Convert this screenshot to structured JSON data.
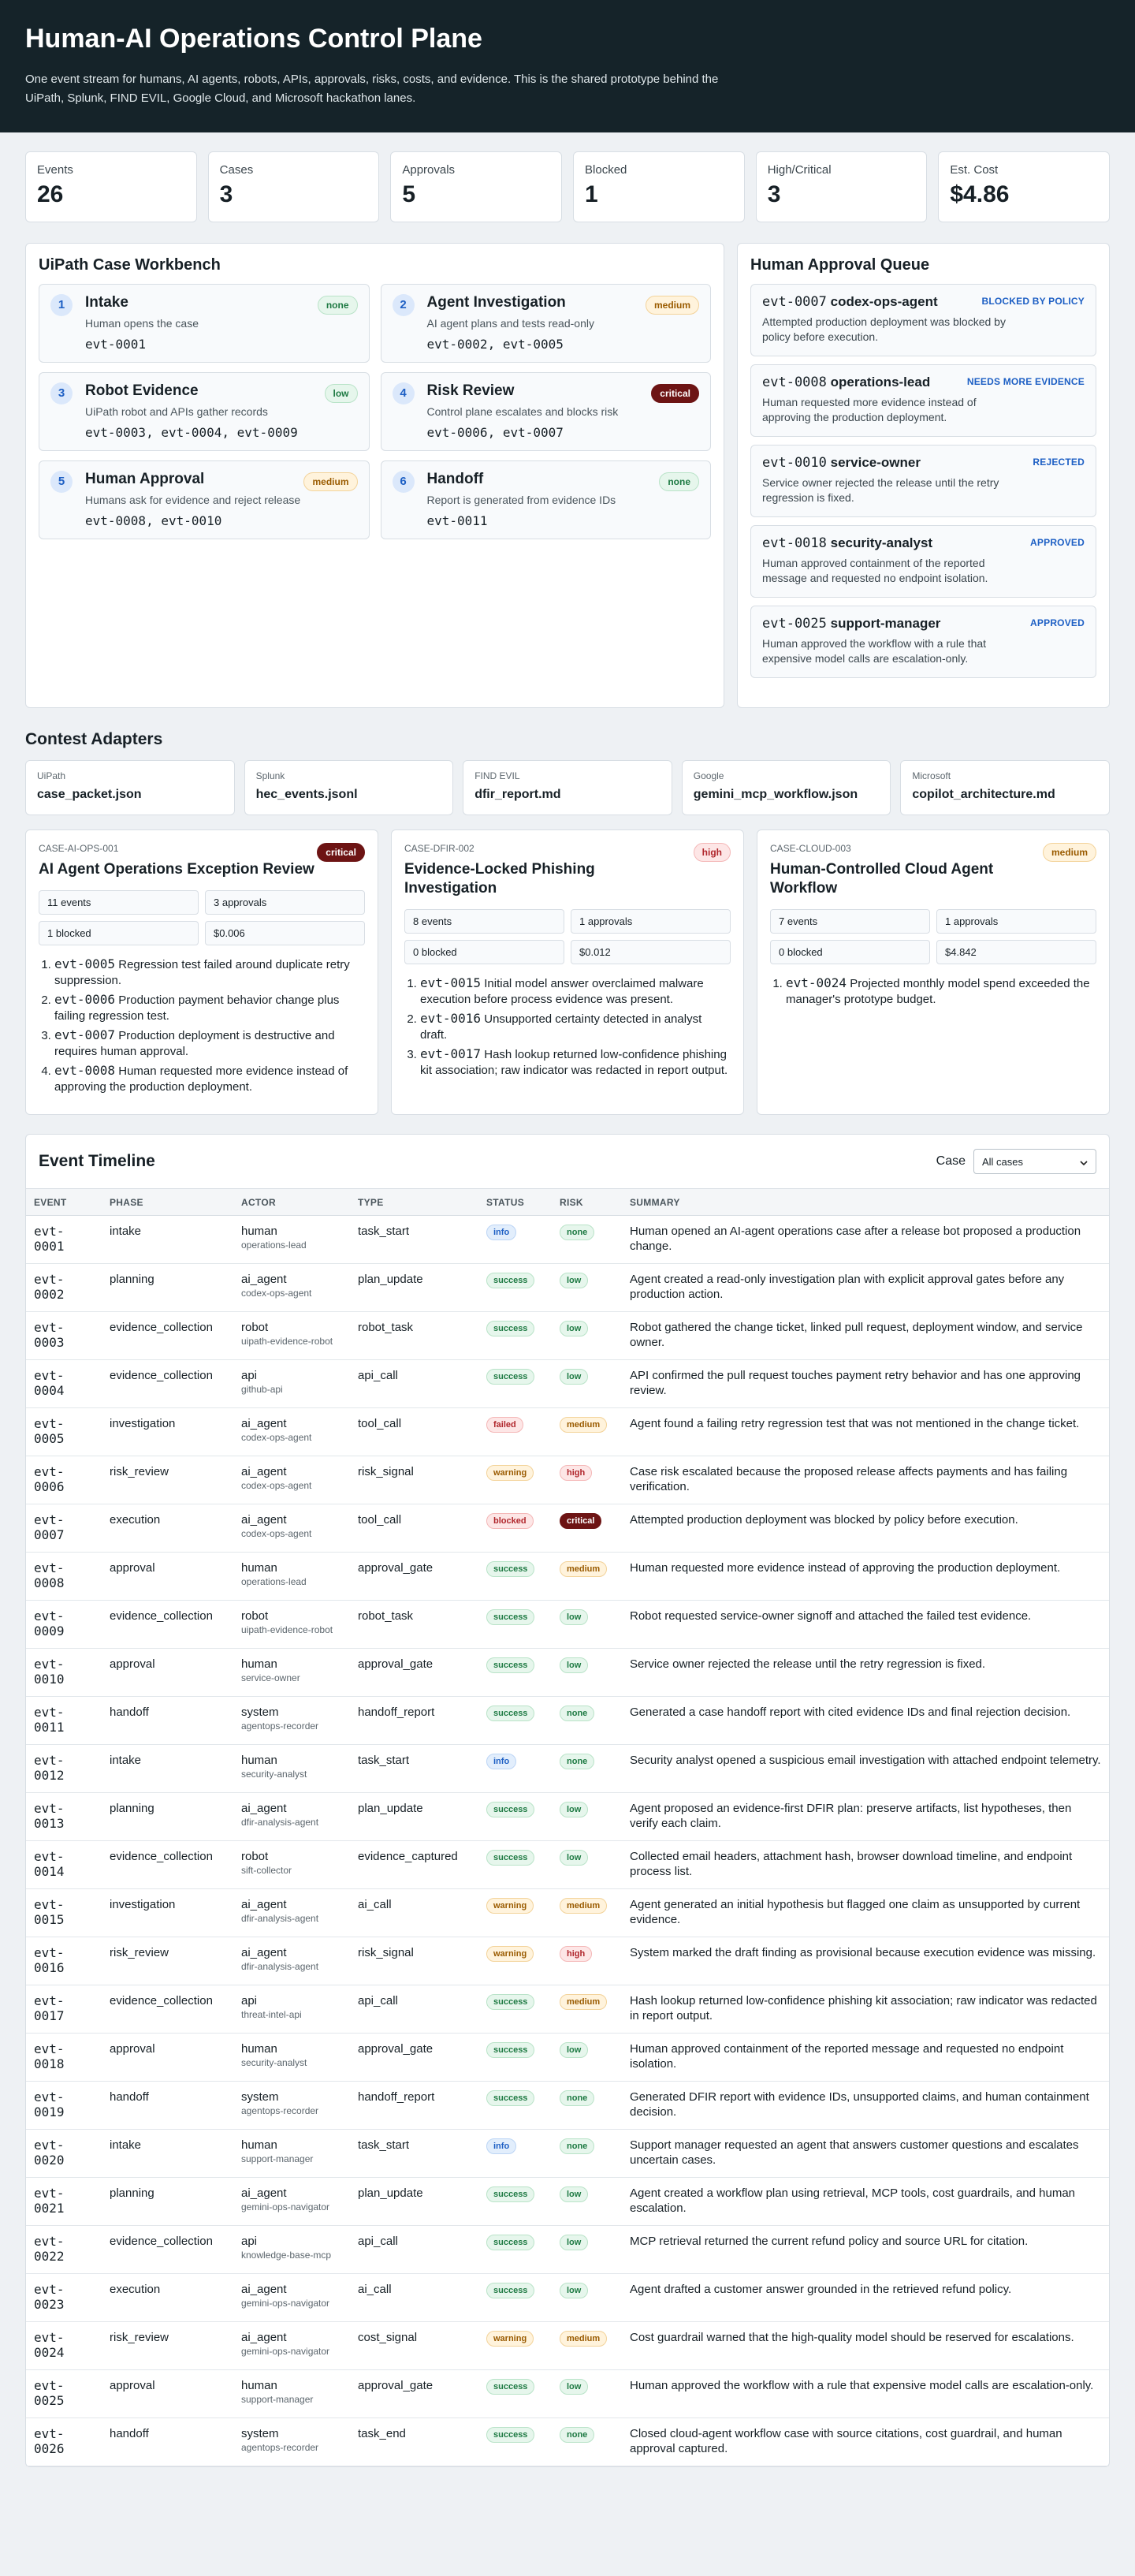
{
  "header": {
    "title": "Human-AI Operations Control Plane",
    "subtitle": "One event stream for humans, AI agents, robots, APIs, approvals, risks, costs, and evidence. This is the shared prototype behind the UiPath, Splunk, FIND EVIL, Google Cloud, and Microsoft hackathon lanes."
  },
  "stats": [
    {
      "label": "Events",
      "value": "26"
    },
    {
      "label": "Cases",
      "value": "3"
    },
    {
      "label": "Approvals",
      "value": "5"
    },
    {
      "label": "Blocked",
      "value": "1"
    },
    {
      "label": "High/Critical",
      "value": "3"
    },
    {
      "label": "Est. Cost",
      "value": "$4.86"
    }
  ],
  "workbench": {
    "title": "UiPath Case Workbench",
    "stages": [
      {
        "num": "1",
        "title": "Intake",
        "desc": "Human opens the case",
        "events": "evt-0001",
        "risk": "none"
      },
      {
        "num": "2",
        "title": "Agent Investigation",
        "desc": "AI agent plans and tests read-only",
        "events": "evt-0002, evt-0005",
        "risk": "medium"
      },
      {
        "num": "3",
        "title": "Robot Evidence",
        "desc": "UiPath robot and APIs gather records",
        "events": "evt-0003, evt-0004, evt-0009",
        "risk": "low"
      },
      {
        "num": "4",
        "title": "Risk Review",
        "desc": "Control plane escalates and blocks risk",
        "events": "evt-0006, evt-0007",
        "risk": "critical"
      },
      {
        "num": "5",
        "title": "Human Approval",
        "desc": "Humans ask for evidence and reject release",
        "events": "evt-0008, evt-0010",
        "risk": "medium"
      },
      {
        "num": "6",
        "title": "Handoff",
        "desc": "Report is generated from evidence IDs",
        "events": "evt-0011",
        "risk": "none"
      }
    ]
  },
  "queue": {
    "title": "Human Approval Queue",
    "items": [
      {
        "evt": "evt-0007",
        "actor": "codex-ops-agent",
        "status": "BLOCKED BY POLICY",
        "desc": "Attempted production deployment was blocked by policy before execution."
      },
      {
        "evt": "evt-0008",
        "actor": "operations-lead",
        "status": "NEEDS MORE EVIDENCE",
        "desc": "Human requested more evidence instead of approving the production deployment."
      },
      {
        "evt": "evt-0010",
        "actor": "service-owner",
        "status": "REJECTED",
        "desc": "Service owner rejected the release until the retry regression is fixed."
      },
      {
        "evt": "evt-0018",
        "actor": "security-analyst",
        "status": "APPROVED",
        "desc": "Human approved containment of the reported message and requested no endpoint isolation."
      },
      {
        "evt": "evt-0025",
        "actor": "support-manager",
        "status": "APPROVED",
        "desc": "Human approved the workflow with a rule that expensive model calls are escalation-only."
      }
    ]
  },
  "adapters": {
    "title": "Contest Adapters",
    "items": [
      {
        "vendor": "UiPath",
        "file": "case_packet.json"
      },
      {
        "vendor": "Splunk",
        "file": "hec_events.jsonl"
      },
      {
        "vendor": "FIND EVIL",
        "file": "dfir_report.md"
      },
      {
        "vendor": "Google",
        "file": "gemini_mcp_workflow.json"
      },
      {
        "vendor": "Microsoft",
        "file": "copilot_architecture.md"
      }
    ]
  },
  "cases": [
    {
      "id": "CASE-AI-OPS-001",
      "risk": "critical",
      "title": "AI Agent Operations Exception Review",
      "events": "11 events",
      "approvals": "3 approvals",
      "blocked": "1 blocked",
      "cost": "$0.006",
      "items": [
        {
          "evt": "evt-0005",
          "text": "Regression test failed around duplicate retry suppression."
        },
        {
          "evt": "evt-0006",
          "text": "Production payment behavior change plus failing regression test."
        },
        {
          "evt": "evt-0007",
          "text": "Production deployment is destructive and requires human approval."
        },
        {
          "evt": "evt-0008",
          "text": "Human requested more evidence instead of approving the production deployment."
        }
      ]
    },
    {
      "id": "CASE-DFIR-002",
      "risk": "high",
      "title": "Evidence-Locked Phishing Investigation",
      "events": "8 events",
      "approvals": "1 approvals",
      "blocked": "0 blocked",
      "cost": "$0.012",
      "items": [
        {
          "evt": "evt-0015",
          "text": "Initial model answer overclaimed malware execution before process evidence was present."
        },
        {
          "evt": "evt-0016",
          "text": "Unsupported certainty detected in analyst draft."
        },
        {
          "evt": "evt-0017",
          "text": "Hash lookup returned low-confidence phishing kit association; raw indicator was redacted in report output."
        }
      ]
    },
    {
      "id": "CASE-CLOUD-003",
      "risk": "medium",
      "title": "Human-Controlled Cloud Agent Workflow",
      "events": "7 events",
      "approvals": "1 approvals",
      "blocked": "0 blocked",
      "cost": "$4.842",
      "items": [
        {
          "evt": "evt-0024",
          "text": "Projected monthly model spend exceeded the manager's prototype budget."
        }
      ]
    }
  ],
  "timeline": {
    "title": "Event Timeline",
    "filter_label": "Case",
    "filter_value": "All cases",
    "columns": [
      "EVENT",
      "PHASE",
      "ACTOR",
      "TYPE",
      "STATUS",
      "RISK",
      "SUMMARY"
    ],
    "rows": [
      {
        "evt": "evt-0001",
        "phase": "intake",
        "actor": "human",
        "actor_id": "operations-lead",
        "type": "task_start",
        "status": "info",
        "risk": "none",
        "summary": "Human opened an AI-agent operations case after a release bot proposed a production change."
      },
      {
        "evt": "evt-0002",
        "phase": "planning",
        "actor": "ai_agent",
        "actor_id": "codex-ops-agent",
        "type": "plan_update",
        "status": "success",
        "risk": "low",
        "summary": "Agent created a read-only investigation plan with explicit approval gates before any production action."
      },
      {
        "evt": "evt-0003",
        "phase": "evidence_collection",
        "actor": "robot",
        "actor_id": "uipath-evidence-robot",
        "type": "robot_task",
        "status": "success",
        "risk": "low",
        "summary": "Robot gathered the change ticket, linked pull request, deployment window, and service owner."
      },
      {
        "evt": "evt-0004",
        "phase": "evidence_collection",
        "actor": "api",
        "actor_id": "github-api",
        "type": "api_call",
        "status": "success",
        "risk": "low",
        "summary": "API confirmed the pull request touches payment retry behavior and has one approving review."
      },
      {
        "evt": "evt-0005",
        "phase": "investigation",
        "actor": "ai_agent",
        "actor_id": "codex-ops-agent",
        "type": "tool_call",
        "status": "failed",
        "risk": "medium",
        "summary": "Agent found a failing retry regression test that was not mentioned in the change ticket."
      },
      {
        "evt": "evt-0006",
        "phase": "risk_review",
        "actor": "ai_agent",
        "actor_id": "codex-ops-agent",
        "type": "risk_signal",
        "status": "warning",
        "risk": "high",
        "summary": "Case risk escalated because the proposed release affects payments and has failing verification."
      },
      {
        "evt": "evt-0007",
        "phase": "execution",
        "actor": "ai_agent",
        "actor_id": "codex-ops-agent",
        "type": "tool_call",
        "status": "blocked",
        "risk": "critical",
        "summary": "Attempted production deployment was blocked by policy before execution."
      },
      {
        "evt": "evt-0008",
        "phase": "approval",
        "actor": "human",
        "actor_id": "operations-lead",
        "type": "approval_gate",
        "status": "success",
        "risk": "medium",
        "summary": "Human requested more evidence instead of approving the production deployment."
      },
      {
        "evt": "evt-0009",
        "phase": "evidence_collection",
        "actor": "robot",
        "actor_id": "uipath-evidence-robot",
        "type": "robot_task",
        "status": "success",
        "risk": "low",
        "summary": "Robot requested service-owner signoff and attached the failed test evidence."
      },
      {
        "evt": "evt-0010",
        "phase": "approval",
        "actor": "human",
        "actor_id": "service-owner",
        "type": "approval_gate",
        "status": "success",
        "risk": "low",
        "summary": "Service owner rejected the release until the retry regression is fixed."
      },
      {
        "evt": "evt-0011",
        "phase": "handoff",
        "actor": "system",
        "actor_id": "agentops-recorder",
        "type": "handoff_report",
        "status": "success",
        "risk": "none",
        "summary": "Generated a case handoff report with cited evidence IDs and final rejection decision."
      },
      {
        "evt": "evt-0012",
        "phase": "intake",
        "actor": "human",
        "actor_id": "security-analyst",
        "type": "task_start",
        "status": "info",
        "risk": "none",
        "summary": "Security analyst opened a suspicious email investigation with attached endpoint telemetry."
      },
      {
        "evt": "evt-0013",
        "phase": "planning",
        "actor": "ai_agent",
        "actor_id": "dfir-analysis-agent",
        "type": "plan_update",
        "status": "success",
        "risk": "low",
        "summary": "Agent proposed an evidence-first DFIR plan: preserve artifacts, list hypotheses, then verify each claim."
      },
      {
        "evt": "evt-0014",
        "phase": "evidence_collection",
        "actor": "robot",
        "actor_id": "sift-collector",
        "type": "evidence_captured",
        "status": "success",
        "risk": "low",
        "summary": "Collected email headers, attachment hash, browser download timeline, and endpoint process list."
      },
      {
        "evt": "evt-0015",
        "phase": "investigation",
        "actor": "ai_agent",
        "actor_id": "dfir-analysis-agent",
        "type": "ai_call",
        "status": "warning",
        "risk": "medium",
        "summary": "Agent generated an initial hypothesis but flagged one claim as unsupported by current evidence."
      },
      {
        "evt": "evt-0016",
        "phase": "risk_review",
        "actor": "ai_agent",
        "actor_id": "dfir-analysis-agent",
        "type": "risk_signal",
        "status": "warning",
        "risk": "high",
        "summary": "System marked the draft finding as provisional because execution evidence was missing."
      },
      {
        "evt": "evt-0017",
        "phase": "evidence_collection",
        "actor": "api",
        "actor_id": "threat-intel-api",
        "type": "api_call",
        "status": "success",
        "risk": "medium",
        "summary": "Hash lookup returned low-confidence phishing kit association; raw indicator was redacted in report output."
      },
      {
        "evt": "evt-0018",
        "phase": "approval",
        "actor": "human",
        "actor_id": "security-analyst",
        "type": "approval_gate",
        "status": "success",
        "risk": "low",
        "summary": "Human approved containment of the reported message and requested no endpoint isolation."
      },
      {
        "evt": "evt-0019",
        "phase": "handoff",
        "actor": "system",
        "actor_id": "agentops-recorder",
        "type": "handoff_report",
        "status": "success",
        "risk": "none",
        "summary": "Generated DFIR report with evidence IDs, unsupported claims, and human containment decision."
      },
      {
        "evt": "evt-0020",
        "phase": "intake",
        "actor": "human",
        "actor_id": "support-manager",
        "type": "task_start",
        "status": "info",
        "risk": "none",
        "summary": "Support manager requested an agent that answers customer questions and escalates uncertain cases."
      },
      {
        "evt": "evt-0021",
        "phase": "planning",
        "actor": "ai_agent",
        "actor_id": "gemini-ops-navigator",
        "type": "plan_update",
        "status": "success",
        "risk": "low",
        "summary": "Agent created a workflow plan using retrieval, MCP tools, cost guardrails, and human escalation."
      },
      {
        "evt": "evt-0022",
        "phase": "evidence_collection",
        "actor": "api",
        "actor_id": "knowledge-base-mcp",
        "type": "api_call",
        "status": "success",
        "risk": "low",
        "summary": "MCP retrieval returned the current refund policy and source URL for citation."
      },
      {
        "evt": "evt-0023",
        "phase": "execution",
        "actor": "ai_agent",
        "actor_id": "gemini-ops-navigator",
        "type": "ai_call",
        "status": "success",
        "risk": "low",
        "summary": "Agent drafted a customer answer grounded in the retrieved refund policy."
      },
      {
        "evt": "evt-0024",
        "phase": "risk_review",
        "actor": "ai_agent",
        "actor_id": "gemini-ops-navigator",
        "type": "cost_signal",
        "status": "warning",
        "risk": "medium",
        "summary": "Cost guardrail warned that the high-quality model should be reserved for escalations."
      },
      {
        "evt": "evt-0025",
        "phase": "approval",
        "actor": "human",
        "actor_id": "support-manager",
        "type": "approval_gate",
        "status": "success",
        "risk": "low",
        "summary": "Human approved the workflow with a rule that expensive model calls are escalation-only."
      },
      {
        "evt": "evt-0026",
        "phase": "handoff",
        "actor": "system",
        "actor_id": "agentops-recorder",
        "type": "task_end",
        "status": "success",
        "risk": "none",
        "summary": "Closed cloud-agent workflow case with source citations, cost guardrail, and human approval captured."
      }
    ]
  }
}
